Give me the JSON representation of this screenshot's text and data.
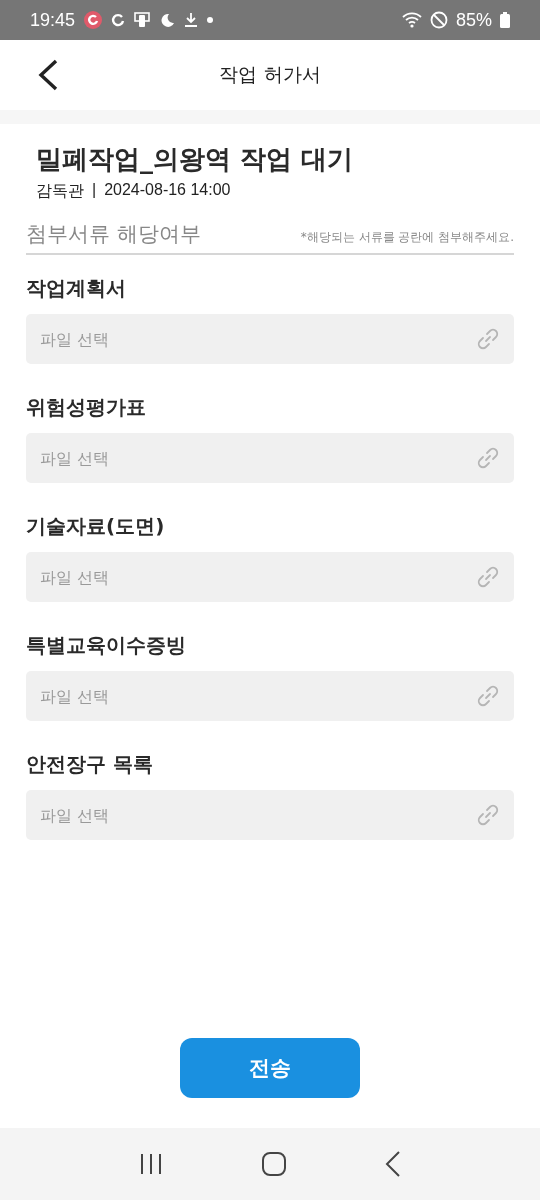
{
  "status_bar": {
    "time": "19:45",
    "battery": "85%"
  },
  "header": {
    "title": "작업 허가서"
  },
  "work": {
    "title": "밀폐작업_의왕역 작업 대기",
    "role": "감독관",
    "separator": "|",
    "datetime": "2024-08-16 14:00"
  },
  "attachments": {
    "heading": "첨부서류 해당여부",
    "note": "*해당되는 서류를 공란에 첨부해주세요.",
    "items": [
      {
        "label": "작업계획서",
        "placeholder": "파일 선택"
      },
      {
        "label": "위험성평가표",
        "placeholder": "파일 선택"
      },
      {
        "label": "기술자료(도면)",
        "placeholder": "파일 선택"
      },
      {
        "label": "특별교육이수증빙",
        "placeholder": "파일 선택"
      },
      {
        "label": "안전장구 목록",
        "placeholder": "파일 선택"
      }
    ]
  },
  "submit_button": "전송"
}
